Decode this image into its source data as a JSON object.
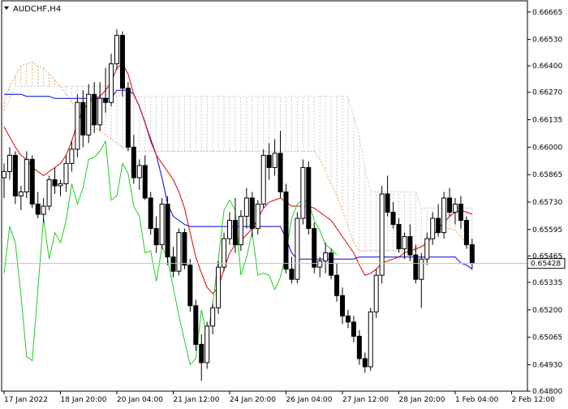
{
  "chart_data": {
    "type": "candlestick",
    "title": "AUDCHF,H4",
    "ylim": [
      0.648,
      0.6672
    ],
    "y_ticks": [
      "0.66665",
      "0.66530",
      "0.66400",
      "0.66270",
      "0.66135",
      "0.66000",
      "0.65865",
      "0.65730",
      "0.65595",
      "0.65465",
      "0.65335",
      "0.65200",
      "0.65065",
      "0.64930",
      "0.64800"
    ],
    "x_ticks": [
      {
        "index": 0,
        "label": "17 Jan 2022"
      },
      {
        "index": 10,
        "label": "18 Jan 20:00"
      },
      {
        "index": 20,
        "label": "20 Jan 04:00"
      },
      {
        "index": 30,
        "label": "21 Jan 12:00"
      },
      {
        "index": 40,
        "label": "24 Jan 20:00"
      },
      {
        "index": 50,
        "label": "26 Jan 04:00"
      },
      {
        "index": 60,
        "label": "27 Jan 12:00"
      },
      {
        "index": 70,
        "label": "28 Jan 20:00"
      },
      {
        "index": 80,
        "label": "1 Feb 04:00"
      },
      {
        "index": 90,
        "label": "2 Feb 12:00"
      }
    ],
    "current_price": {
      "value": 0.65428,
      "label": "0.65428"
    },
    "candles": [
      [
        0.6585,
        0.6592,
        0.6575,
        0.6588
      ],
      [
        0.6588,
        0.66,
        0.6584,
        0.6596
      ],
      [
        0.6596,
        0.6598,
        0.6572,
        0.6576
      ],
      [
        0.6576,
        0.6581,
        0.6569,
        0.6578
      ],
      [
        0.6578,
        0.6598,
        0.6575,
        0.6594
      ],
      [
        0.6594,
        0.6596,
        0.657,
        0.6572
      ],
      [
        0.6572,
        0.6578,
        0.6565,
        0.6567
      ],
      [
        0.6567,
        0.6575,
        0.6563,
        0.6571
      ],
      [
        0.6571,
        0.6586,
        0.6569,
        0.6584
      ],
      [
        0.6584,
        0.659,
        0.6577,
        0.6581
      ],
      [
        0.6581,
        0.6584,
        0.6576,
        0.6582
      ],
      [
        0.6582,
        0.6596,
        0.6578,
        0.6592
      ],
      [
        0.6592,
        0.6603,
        0.6588,
        0.6599
      ],
      [
        0.6599,
        0.6626,
        0.6595,
        0.6622
      ],
      [
        0.6622,
        0.6628,
        0.66,
        0.6606
      ],
      [
        0.6606,
        0.6631,
        0.6602,
        0.6626
      ],
      [
        0.6626,
        0.6632,
        0.6607,
        0.6611
      ],
      [
        0.6611,
        0.6632,
        0.6608,
        0.6624
      ],
      [
        0.6624,
        0.6639,
        0.6617,
        0.6622
      ],
      [
        0.6622,
        0.6646,
        0.662,
        0.6641
      ],
      [
        0.6641,
        0.6658,
        0.6638,
        0.6655
      ],
      [
        0.6655,
        0.6657,
        0.6625,
        0.6629
      ],
      [
        0.6629,
        0.6632,
        0.6598,
        0.66
      ],
      [
        0.66,
        0.6606,
        0.6582,
        0.6585
      ],
      [
        0.6585,
        0.6594,
        0.6579,
        0.6591
      ],
      [
        0.6591,
        0.6596,
        0.6574,
        0.6575
      ],
      [
        0.6575,
        0.6578,
        0.6557,
        0.656
      ],
      [
        0.656,
        0.6566,
        0.6548,
        0.6552
      ],
      [
        0.6552,
        0.6575,
        0.655,
        0.6572
      ],
      [
        0.6572,
        0.6576,
        0.6542,
        0.6546
      ],
      [
        0.6546,
        0.6551,
        0.6536,
        0.6539
      ],
      [
        0.6539,
        0.656,
        0.6537,
        0.6558
      ],
      [
        0.6558,
        0.656,
        0.654,
        0.6542
      ],
      [
        0.6542,
        0.6545,
        0.6519,
        0.6522
      ],
      [
        0.6522,
        0.6525,
        0.65,
        0.6503
      ],
      [
        0.6503,
        0.6508,
        0.6485,
        0.6494
      ],
      [
        0.6494,
        0.6514,
        0.6491,
        0.6512
      ],
      [
        0.6512,
        0.6523,
        0.6508,
        0.6521
      ],
      [
        0.6521,
        0.6544,
        0.6518,
        0.6541
      ],
      [
        0.6541,
        0.6558,
        0.6539,
        0.6555
      ],
      [
        0.6555,
        0.6568,
        0.6552,
        0.6564
      ],
      [
        0.6564,
        0.6575,
        0.6548,
        0.6552
      ],
      [
        0.6552,
        0.6569,
        0.6549,
        0.6566
      ],
      [
        0.6566,
        0.658,
        0.656,
        0.6575
      ],
      [
        0.6575,
        0.6578,
        0.6556,
        0.656
      ],
      [
        0.656,
        0.6574,
        0.6557,
        0.6572
      ],
      [
        0.6572,
        0.6599,
        0.657,
        0.6596
      ],
      [
        0.6596,
        0.6602,
        0.6584,
        0.659
      ],
      [
        0.659,
        0.6604,
        0.6586,
        0.6597
      ],
      [
        0.6597,
        0.6608,
        0.6575,
        0.6578
      ],
      [
        0.6578,
        0.6582,
        0.6538,
        0.654
      ],
      [
        0.654,
        0.6546,
        0.6533,
        0.6535
      ],
      [
        0.6535,
        0.6568,
        0.6533,
        0.6565
      ],
      [
        0.6565,
        0.6594,
        0.6562,
        0.659
      ],
      [
        0.659,
        0.6593,
        0.6557,
        0.656
      ],
      [
        0.656,
        0.6563,
        0.6538,
        0.6541
      ],
      [
        0.6541,
        0.6546,
        0.6536,
        0.6544
      ],
      [
        0.6544,
        0.6553,
        0.6538,
        0.6548
      ],
      [
        0.6548,
        0.655,
        0.6535,
        0.6537
      ],
      [
        0.6537,
        0.6543,
        0.6524,
        0.6527
      ],
      [
        0.6527,
        0.6531,
        0.6513,
        0.6517
      ],
      [
        0.6517,
        0.652,
        0.6511,
        0.6514
      ],
      [
        0.6514,
        0.6517,
        0.6504,
        0.6507
      ],
      [
        0.6507,
        0.651,
        0.6493,
        0.6496
      ],
      [
        0.6496,
        0.6499,
        0.6489,
        0.6492
      ],
      [
        0.6492,
        0.6521,
        0.649,
        0.6519
      ],
      [
        0.6519,
        0.654,
        0.6516,
        0.6537
      ],
      [
        0.6537,
        0.6581,
        0.6533,
        0.6577
      ],
      [
        0.6577,
        0.6586,
        0.6566,
        0.6568
      ],
      [
        0.6568,
        0.6573,
        0.656,
        0.6562
      ],
      [
        0.6562,
        0.6565,
        0.6548,
        0.655
      ],
      [
        0.655,
        0.6558,
        0.6545,
        0.6556
      ],
      [
        0.6556,
        0.6562,
        0.6544,
        0.6547
      ],
      [
        0.6547,
        0.6552,
        0.6533,
        0.6535
      ],
      [
        0.6535,
        0.6548,
        0.6521,
        0.6545
      ],
      [
        0.6545,
        0.6558,
        0.6542,
        0.6555
      ],
      [
        0.6555,
        0.6568,
        0.6552,
        0.6565
      ],
      [
        0.6565,
        0.6572,
        0.6556,
        0.6558
      ],
      [
        0.6558,
        0.6578,
        0.6555,
        0.6575
      ],
      [
        0.6575,
        0.658,
        0.6566,
        0.6568
      ],
      [
        0.6568,
        0.6575,
        0.6562,
        0.6572
      ],
      [
        0.6572,
        0.6576,
        0.656,
        0.6564
      ],
      [
        0.6564,
        0.6566,
        0.655,
        0.6552
      ],
      [
        0.6552,
        0.6555,
        0.654,
        0.6543
      ]
    ],
    "indicators": {
      "tenkan_sen": [
        0.661,
        0.6605,
        0.66,
        0.6596,
        0.6594,
        0.659,
        0.6588,
        0.6586,
        0.6588,
        0.659,
        0.6592,
        0.6596,
        0.6603,
        0.6612,
        0.6618,
        0.6622,
        0.6624,
        0.6625,
        0.6628,
        0.6632,
        0.6639,
        0.6641,
        0.6636,
        0.6626,
        0.662,
        0.6612,
        0.6603,
        0.6596,
        0.6592,
        0.6588,
        0.6584,
        0.6578,
        0.657,
        0.6558,
        0.6546,
        0.6538,
        0.6531,
        0.6528,
        0.6531,
        0.654,
        0.6548,
        0.6552,
        0.6554,
        0.6557,
        0.656,
        0.6565,
        0.657,
        0.6573,
        0.6574,
        0.6575,
        0.6573,
        0.6571,
        0.6571,
        0.6571,
        0.6571,
        0.657,
        0.6568,
        0.6566,
        0.6564,
        0.656,
        0.6556,
        0.6552,
        0.6548,
        0.6542,
        0.6537,
        0.6538,
        0.654,
        0.6543,
        0.6544,
        0.6545,
        0.6546,
        0.6548,
        0.6549,
        0.655,
        0.6551,
        0.6553,
        0.6556,
        0.656,
        0.6563,
        0.6566,
        0.6568,
        0.6569,
        0.6568,
        0.6567
      ],
      "kijun_sen": [
        0.6626,
        0.6626,
        0.6626,
        0.6626,
        0.6625,
        0.6625,
        0.6625,
        0.6625,
        0.6625,
        0.6624,
        0.6624,
        0.6624,
        0.6624,
        0.6624,
        0.6624,
        0.6624,
        0.6624,
        0.6624,
        0.6624,
        0.6624,
        0.6628,
        0.6628,
        0.6628,
        0.6626,
        0.662,
        0.6612,
        0.6604,
        0.6596,
        0.6585,
        0.6572,
        0.6566,
        0.6564,
        0.6562,
        0.6561,
        0.6561,
        0.6561,
        0.6561,
        0.6561,
        0.6561,
        0.6561,
        0.6561,
        0.6561,
        0.6561,
        0.6561,
        0.6561,
        0.6561,
        0.6561,
        0.6561,
        0.6561,
        0.6561,
        0.6555,
        0.6548,
        0.6545,
        0.6545,
        0.6545,
        0.6545,
        0.6545,
        0.6545,
        0.6545,
        0.6545,
        0.6545,
        0.6545,
        0.6545,
        0.6546,
        0.6546,
        0.6546,
        0.6546,
        0.6546,
        0.6546,
        0.6546,
        0.6546,
        0.6546,
        0.6546,
        0.6546,
        0.6546,
        0.6546,
        0.6546,
        0.6546,
        0.6546,
        0.6546,
        0.6546,
        0.6543,
        0.6542,
        0.654
      ],
      "senkou_a": [
        0.6622,
        0.663,
        0.6635,
        0.664,
        0.6641,
        0.6642,
        0.664,
        0.6639,
        0.6636,
        0.6633,
        0.663,
        0.6626,
        0.6622,
        0.6618,
        0.6615,
        0.6612,
        0.661,
        0.6608,
        0.6606,
        0.6604,
        0.6602,
        0.66,
        0.6599,
        0.6598,
        0.6598,
        0.6598,
        0.6598,
        0.6598,
        0.6598,
        0.6598,
        0.6598,
        0.6598,
        0.6598,
        0.6598,
        0.6598,
        0.6598,
        0.6598,
        0.6598,
        0.6598,
        0.6598,
        0.6598,
        0.6598,
        0.6598,
        0.6598,
        0.6598,
        0.6598,
        0.6598,
        0.6598,
        0.6598,
        0.6598,
        0.6598,
        0.6598,
        0.6598,
        0.6598,
        0.6598,
        0.6598,
        0.6594,
        0.6588,
        0.6582,
        0.6576,
        0.6569,
        0.6561,
        0.6553,
        0.6549,
        0.6549,
        0.6549,
        0.6549,
        0.6549,
        0.6549,
        0.6549,
        0.6549,
        0.6549,
        0.6549,
        0.6549,
        0.6551,
        0.6554,
        0.6557,
        0.656,
        0.656,
        0.656,
        0.6559,
        0.6556,
        0.6552,
        0.6548
      ],
      "senkou_b": [
        0.6618,
        0.6624,
        0.663,
        0.663,
        0.663,
        0.663,
        0.663,
        0.663,
        0.663,
        0.663,
        0.663,
        0.663,
        0.663,
        0.663,
        0.663,
        0.663,
        0.663,
        0.663,
        0.663,
        0.663,
        0.6625,
        0.6625,
        0.6625,
        0.6625,
        0.6625,
        0.6625,
        0.6625,
        0.6625,
        0.6625,
        0.6625,
        0.6625,
        0.6625,
        0.6625,
        0.6625,
        0.6625,
        0.6625,
        0.6625,
        0.6625,
        0.6625,
        0.6625,
        0.6625,
        0.6625,
        0.6625,
        0.6625,
        0.6625,
        0.6625,
        0.6625,
        0.6625,
        0.6625,
        0.6625,
        0.6625,
        0.6625,
        0.6625,
        0.6625,
        0.6625,
        0.6625,
        0.6625,
        0.6625,
        0.6625,
        0.6625,
        0.6625,
        0.6625,
        0.6615,
        0.6605,
        0.659,
        0.6578,
        0.6578,
        0.6578,
        0.6578,
        0.6578,
        0.6578,
        0.6578,
        0.6578,
        0.6578,
        0.657,
        0.657,
        0.657,
        0.657,
        0.657,
        0.657,
        0.657,
        0.657,
        0.657,
        0.657
      ],
      "chikou_span": {
        "start_index": 0,
        "values": [
          0.6538,
          0.6561,
          0.6553,
          0.6527,
          0.6497,
          0.6495,
          0.653,
          0.6565,
          0.6545,
          0.6558,
          0.6553,
          0.6564,
          0.6582,
          0.6572,
          0.658,
          0.6594,
          0.6595,
          0.6598,
          0.6603,
          0.6574,
          0.6576,
          0.6592,
          0.6587,
          0.6571,
          0.6566,
          0.6548,
          0.6549,
          0.6534,
          0.6551,
          0.6545,
          0.6531,
          0.6517,
          0.6505,
          0.6493,
          0.6496,
          0.652,
          0.6506,
          0.6523,
          0.6545,
          0.6569,
          0.6574,
          0.6569,
          0.6537,
          0.6546,
          0.6558,
          0.6537,
          0.6538,
          0.6537,
          0.653,
          0.6536,
          0.6548,
          0.6565,
          0.6572,
          0.6574,
          0.6573,
          0.6564,
          0.6559,
          0.6552,
          0.655,
          0.6547
        ]
      }
    }
  }
}
